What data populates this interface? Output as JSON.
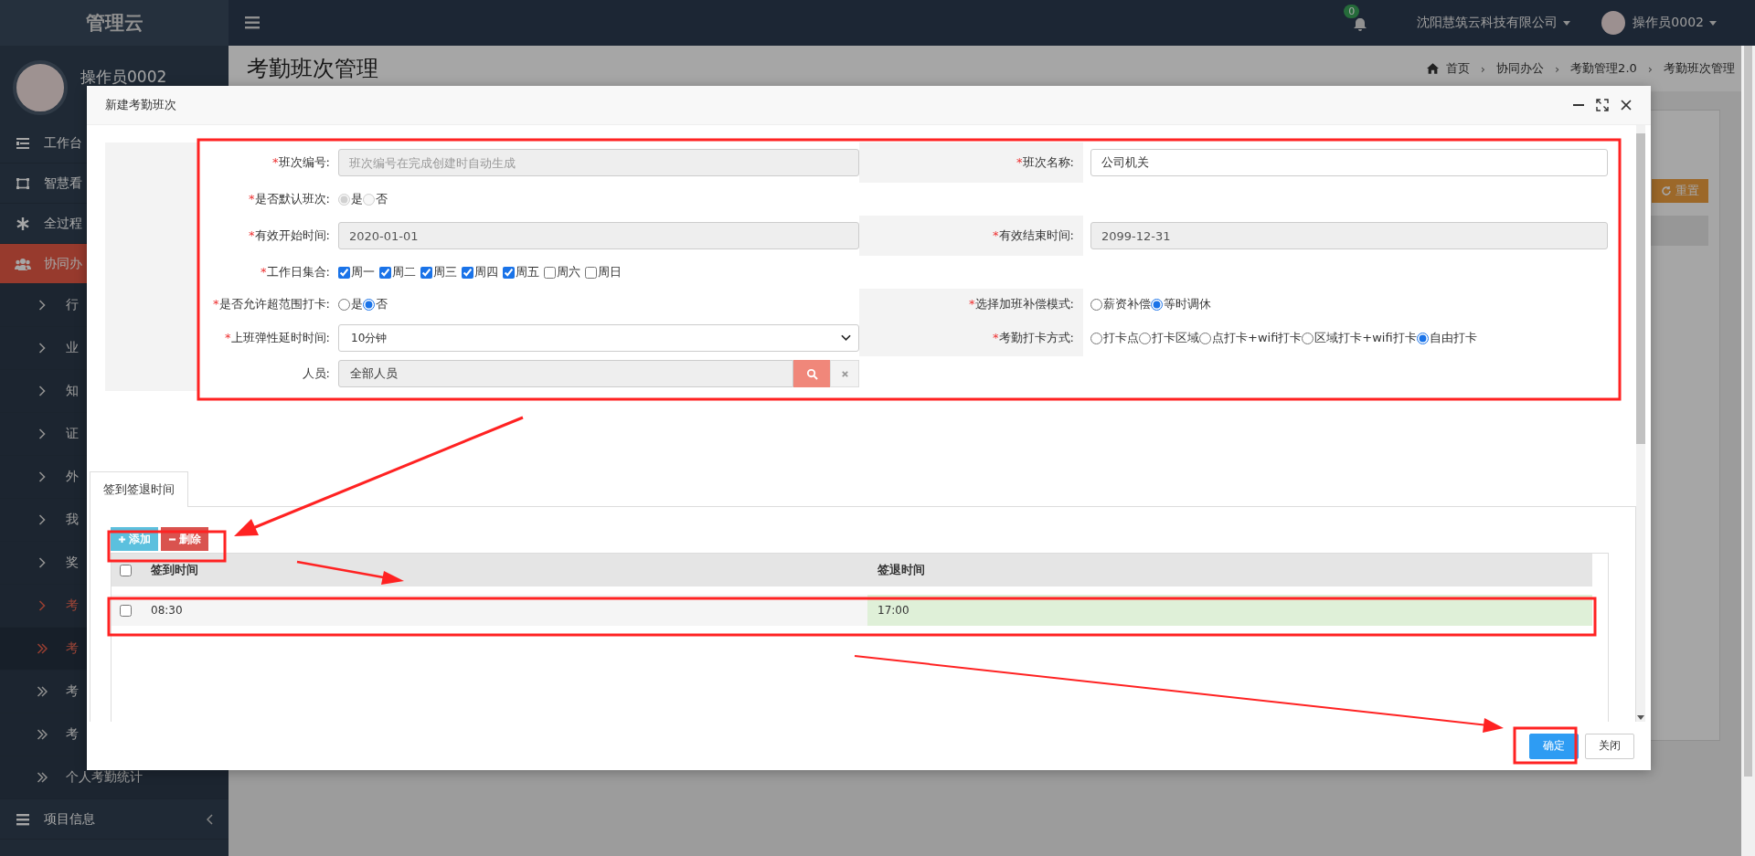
{
  "header": {
    "brand": "管理云",
    "notification_count": "0",
    "company": "沈阳慧筑云科技有限公司",
    "user": "操作员0002"
  },
  "sidebar": {
    "user": "操作员0002",
    "items": [
      {
        "label": "工作台",
        "expanded": false
      },
      {
        "label": "智慧看",
        "expanded": false
      },
      {
        "label": "全过程",
        "expanded": false
      },
      {
        "label": "协同办",
        "expanded": true,
        "children": [
          {
            "label": "行",
            "expanded": false
          },
          {
            "label": "业",
            "expanded": false
          },
          {
            "label": "知",
            "expanded": false
          },
          {
            "label": "证",
            "expanded": false
          },
          {
            "label": "外",
            "expanded": false
          },
          {
            "label": "我",
            "expanded": false
          },
          {
            "label": "奖",
            "expanded": false
          },
          {
            "label": "考",
            "expanded": true,
            "children": [
              {
                "label": "考",
                "selected": true
              },
              {
                "label": "考",
                "selected": false
              },
              {
                "label": "考",
                "selected": false
              },
              {
                "label": "个人考勤统计",
                "selected": false
              }
            ]
          }
        ]
      },
      {
        "label": "项目信息",
        "expanded": false
      }
    ]
  },
  "page": {
    "title": "考勤班次管理",
    "breadcrumb": [
      "首页",
      "协同办公",
      "考勤管理2.0",
      "考勤班次管理"
    ],
    "breadcrumb_separator": "›",
    "reset_button": "重置"
  },
  "modal": {
    "title": "新建考勤班次",
    "form_rows": [
      [
        {
          "mark": "*",
          "label": "班次编号:",
          "kind": "text",
          "placeholder": "班次编号在完成创建时自动生成",
          "disabled": true
        },
        {
          "mark": "*",
          "label": "班次名称:",
          "kind": "text",
          "value": "公司机关",
          "disabled": false
        }
      ],
      [
        {
          "mark": "*",
          "label": "是否默认班次:",
          "kind": "radio",
          "disabled": true,
          "options": [
            {
              "label": "是",
              "selected": true
            },
            {
              "label": "否",
              "selected": false
            }
          ]
        }
      ],
      [
        {
          "mark": "*",
          "label": "有效开始时间:",
          "kind": "text",
          "value": "2020-01-01",
          "disabled": true
        },
        {
          "mark": "*",
          "label": "有效结束时间:",
          "kind": "text",
          "value": "2099-12-31",
          "disabled": true
        }
      ],
      [
        {
          "mark": "*",
          "label": "工作日集合:",
          "kind": "checkbox",
          "options": [
            {
              "label": "周一",
              "checked": true
            },
            {
              "label": "周二",
              "checked": true
            },
            {
              "label": "周三",
              "checked": true
            },
            {
              "label": "周四",
              "checked": true
            },
            {
              "label": "周五",
              "checked": true
            },
            {
              "label": "周六",
              "checked": false
            },
            {
              "label": "周日",
              "checked": false
            }
          ]
        }
      ],
      [
        {
          "mark": "*",
          "label": "是否允许超范围打卡:",
          "kind": "radio",
          "disabled": false,
          "options": [
            {
              "label": "是",
              "selected": false
            },
            {
              "label": "否",
              "selected": true
            }
          ]
        },
        {
          "mark": "*",
          "label": "选择加班补偿模式:",
          "kind": "radio",
          "disabled": false,
          "options": [
            {
              "label": "薪资补偿",
              "selected": false
            },
            {
              "label": "等时调休",
              "selected": true
            }
          ]
        }
      ],
      [
        {
          "mark": "*",
          "label": "上班弹性延时时间:",
          "kind": "select",
          "value": "10分钟"
        },
        {
          "mark": "*",
          "label": "考勤打卡方式:",
          "kind": "radio",
          "disabled": false,
          "options": [
            {
              "label": "打卡点",
              "selected": false
            },
            {
              "label": "打卡区域",
              "selected": false
            },
            {
              "label": "点打卡+wifi打卡",
              "selected": false
            },
            {
              "label": "区域打卡+wifi打卡",
              "selected": false
            },
            {
              "label": "自由打卡",
              "selected": true
            }
          ]
        }
      ],
      [
        {
          "label": "人员:",
          "kind": "picker",
          "value": "全部人员"
        }
      ]
    ],
    "tabs": [
      {
        "label": "签到签退时间",
        "selected": true
      }
    ],
    "toolbar": [
      {
        "label": "添加",
        "kind": "add"
      },
      {
        "label": "删除",
        "kind": "delete"
      }
    ],
    "table": {
      "header_checked": false,
      "columns": [
        "签到时间",
        "签退时间"
      ],
      "rows": [
        {
          "checked": false,
          "cells": [
            {
              "text": "08:30",
              "highlighted": false
            },
            {
              "text": "17:00",
              "highlighted": true
            }
          ]
        }
      ]
    },
    "buttons": [
      {
        "label": "确定",
        "kind": "primary"
      },
      {
        "label": "关闭",
        "kind": "default"
      }
    ]
  }
}
